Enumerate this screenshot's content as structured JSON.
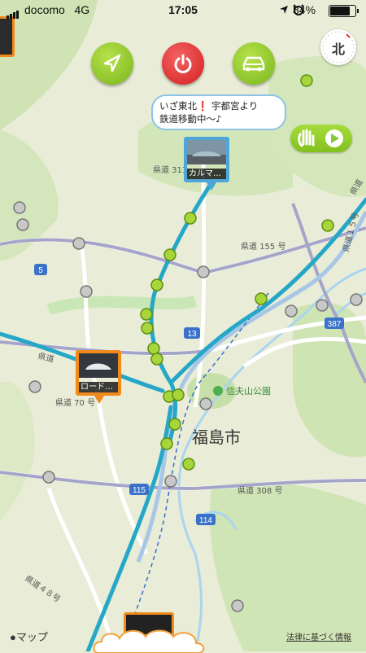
{
  "status_bar": {
    "carrier": "docomo",
    "network": "4G",
    "time": "17:05",
    "battery": "84%",
    "battery_level": 0.84
  },
  "controls": {
    "navigate_icon": "location-arrow-icon",
    "power_icon": "power-icon",
    "car_icon": "car-icon",
    "compass_label": "北"
  },
  "message_bubble": {
    "line1": "いざ東北❗️ 宇都宮より",
    "line2": "鉄道移動中〜♪"
  },
  "photo_pins": [
    {
      "label": "カルマ…",
      "border": "#4ea6d8"
    },
    {
      "label": "ロード…",
      "border": "#f08a1c"
    }
  ],
  "map_labels": {
    "city": "福島市",
    "park": "信夫山公園",
    "road_313": "県道 313",
    "road_155": "県道 155 号",
    "road_70": "県道 70 号",
    "road_308": "県道 308 号",
    "route_5": "5",
    "route_13": "13",
    "route_387": "387",
    "route_115": "115",
    "route_114": "114",
    "road_left": "県道",
    "road_diag": "県道４８号",
    "road_diag2": "県道１５号",
    "road_top_right": "県道"
  },
  "footer": {
    "maps_brand": "マップ",
    "legal": "法律に基づく情報"
  },
  "colors": {
    "route_line": "#25a7c8",
    "green_pin": "#a6d63a",
    "gray_pin": "#c8c8c8",
    "map_bg": "#e9ecd6"
  }
}
